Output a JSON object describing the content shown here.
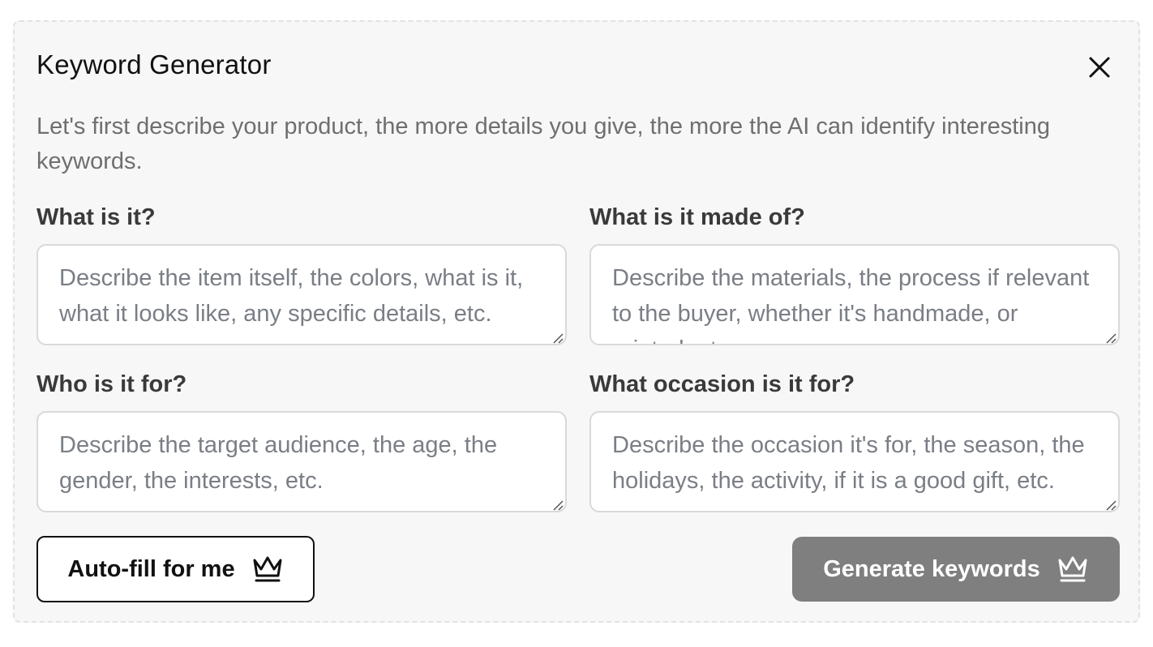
{
  "dialog": {
    "title": "Keyword Generator",
    "close_icon": "close-icon",
    "intro": "Let's first describe your product, the more details you give, the more the AI can identify interesting keywords."
  },
  "fields": [
    {
      "label": "What is it?",
      "placeholder": "Describe the item itself, the colors, what is it, what it looks like, any specific details, etc.",
      "value": ""
    },
    {
      "label": "What is it made of?",
      "placeholder": "Describe the materials, the process if relevant to the buyer, whether it's handmade, or printed, etc.",
      "value": ""
    },
    {
      "label": "Who is it for?",
      "placeholder": "Describe the target audience, the age, the gender, the interests, etc.",
      "value": ""
    },
    {
      "label": "What occasion is it for?",
      "placeholder": "Describe the occasion it's for, the season, the holidays, the activity, if it is a good gift, etc.",
      "value": ""
    }
  ],
  "actions": {
    "autofill_label": "Auto-fill for me",
    "generate_label": "Generate keywords",
    "icon": "crown-icon"
  },
  "colors": {
    "panel_bg": "#f7f7f7",
    "generate_bg": "#7f7f7f",
    "text_dark": "#111111",
    "text_muted": "#6f6f6f"
  }
}
